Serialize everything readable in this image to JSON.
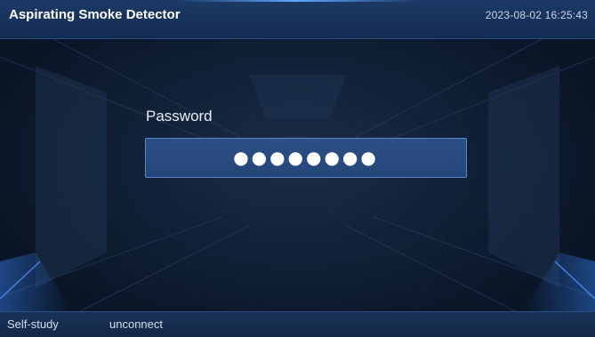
{
  "header": {
    "title": "Aspirating Smoke Detector",
    "datetime": "2023-08-02  16:25:43"
  },
  "login": {
    "password_label": "Password",
    "password_value": "●●●●●●●●"
  },
  "status_bar": {
    "mode": "Self-study",
    "connection": "unconnect"
  },
  "colors": {
    "header_bg": "#1c3a66",
    "field_bg": "#2c4f86",
    "field_border": "#5a86c8",
    "background": "#122238"
  }
}
